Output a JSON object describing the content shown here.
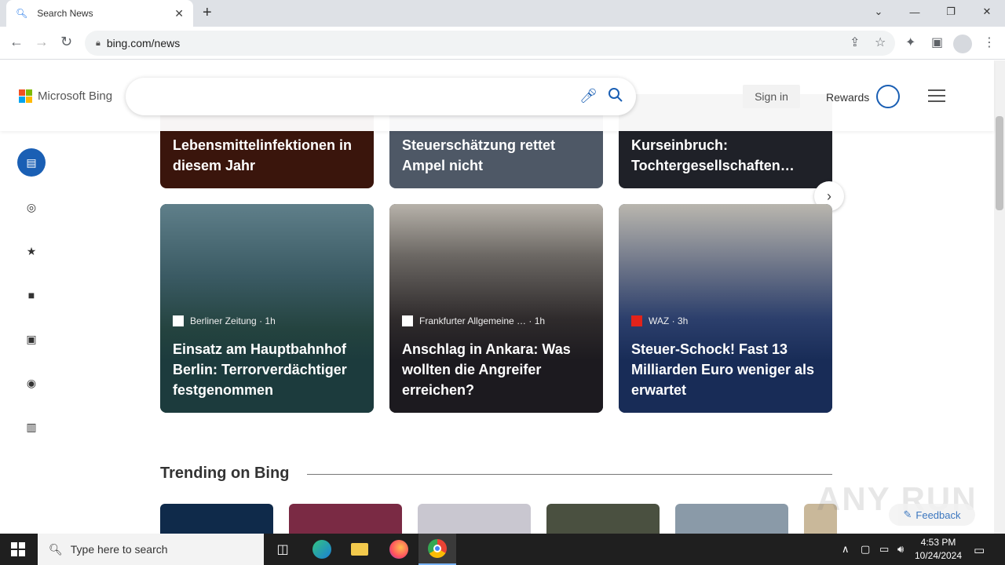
{
  "browser": {
    "tab_title": "Search News",
    "url": "bing.com/news"
  },
  "bing": {
    "logo_text": "Microsoft Bing",
    "sign_in": "Sign in",
    "rewards": "Rewards"
  },
  "left_rail": [
    "news-icon",
    "globe-icon",
    "star-icon",
    "briefcase-icon",
    "clapperboard-icon",
    "sports-ball-icon",
    "books-icon"
  ],
  "top_cards": [
    {
      "headline": "Lebensmittelinfektionen in diesem Jahr",
      "color": "#3a150c"
    },
    {
      "headline": "Steuerschätzung rettet Ampel nicht",
      "color": "#4e5866"
    },
    {
      "headline": "Kurseinbruch: Tochtergesellschaften…",
      "color": "#1f2128"
    }
  ],
  "cards": [
    {
      "source": "Berliner Zeitung",
      "time": "· 1h",
      "headline": "Einsatz am Hauptbahnhof Berlin: Terrorverdächtiger festgenommen",
      "color": "#1c3b3d"
    },
    {
      "source": "Frankfurter Allgemeine …",
      "time": "· 1h",
      "headline": "Anschlag in Ankara: Was wollten die Angreifer erreichen?",
      "color": "#1c1a1f"
    },
    {
      "source": "WAZ",
      "time": "· 3h",
      "headline": "Steuer-Schock! Fast 13 Milliarden Euro weniger als erwartet",
      "color": "#182c57"
    }
  ],
  "trending": {
    "title": "Trending on Bing"
  },
  "feedback": "Feedback",
  "watermark": "ANY RUN",
  "taskbar": {
    "search_placeholder": "Type here to search",
    "time": "4:53 PM",
    "date": "10/24/2024"
  }
}
